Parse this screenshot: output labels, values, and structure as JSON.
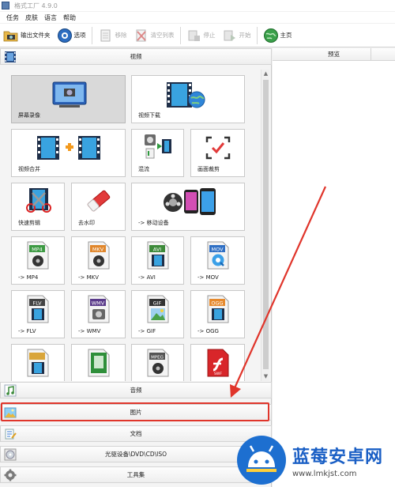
{
  "window": {
    "title": "格式工厂 4.9.0"
  },
  "menu": {
    "items": [
      "任务",
      "皮肤",
      "语言",
      "帮助"
    ]
  },
  "toolbar": {
    "output_folder": "输出文件夹",
    "options": "选项",
    "remove": "移除",
    "clear_list": "清空列表",
    "stop": "停止",
    "start": "开始",
    "home": "主页"
  },
  "categories": {
    "video": "视频",
    "audio": "音频",
    "image": "图片",
    "document": "文档",
    "disc": "光驱设备\\DVD\\CD\\ISO",
    "toolbox": "工具集"
  },
  "tiles": {
    "screen_record": "屏幕录像",
    "video_download": "视频下载",
    "video_merge": "视频合并",
    "mix": "混流",
    "crop": "画面裁剪",
    "quick_cut": "快速剪辑",
    "watermark": "去水印",
    "mobile": "-> 移动设备",
    "mp4": "-> MP4",
    "mkv": "-> MKV",
    "avi": "-> AVI",
    "mov": "-> MOV",
    "flv": "-> FLV",
    "wmv": "-> WMV",
    "gif": "-> GIF",
    "ogg": "-> OGG"
  },
  "file_badges": {
    "mp4": "MP4",
    "mkv": "MKV",
    "avi": "AVI",
    "mov": "MOV",
    "flv": "FLV",
    "wmv": "WMV",
    "gif": "GIF",
    "ogg": "OGG",
    "mpeg": "MPEG",
    "swf": "SWF"
  },
  "preview": {
    "header": "预览"
  },
  "watermark_site": {
    "name": "蓝莓安卓网",
    "url": "www.lmkjst.com"
  },
  "colors": {
    "highlight": "#e0352b",
    "arrow": "#e0352b",
    "brand_blue": "#1a5fc5"
  }
}
